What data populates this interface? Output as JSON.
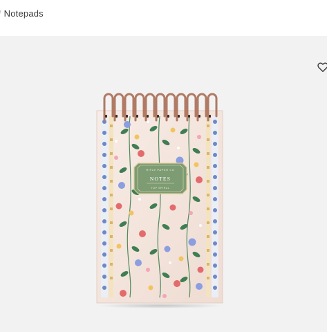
{
  "breadcrumb": {
    "separator": "/",
    "current": "Notepads"
  },
  "product": {
    "cover_label_top": "RIFLE PAPER CO",
    "cover_label_main": "NOTES",
    "cover_label_bottom": "TOP SPIRAL",
    "colors": {
      "cover": "#f4e6df",
      "label": "#7a9a72",
      "spiral": "#b9826a",
      "stage": "#f2f2f2"
    }
  },
  "icons": {
    "wishlist": "heart-outline-icon"
  }
}
